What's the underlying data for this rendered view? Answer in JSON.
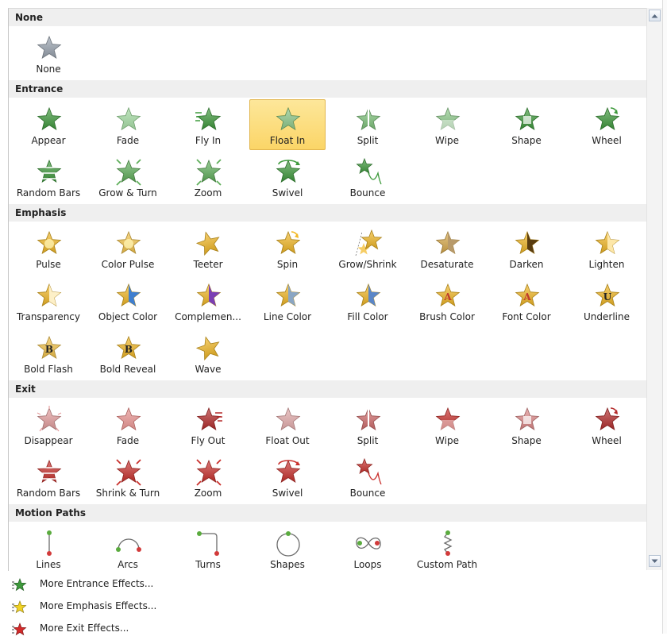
{
  "sections": [
    {
      "title": "None",
      "items": [
        {
          "label": "None",
          "icon": "star-gray-icon",
          "color": "#9aa4b0",
          "variant": "plain"
        }
      ]
    },
    {
      "title": "Entrance",
      "items": [
        {
          "label": "Appear",
          "icon": "entrance-appear-icon",
          "color": "#3e9a3c",
          "variant": "plain"
        },
        {
          "label": "Fade",
          "icon": "entrance-fade-icon",
          "color": "#6cc26a",
          "variant": "fade"
        },
        {
          "label": "Fly In",
          "icon": "entrance-fly-in-icon",
          "color": "#3e9a3c",
          "variant": "fly"
        },
        {
          "label": "Float In",
          "icon": "entrance-float-in-icon",
          "color": "#5faf5a",
          "variant": "float",
          "selected": true
        },
        {
          "label": "Split",
          "icon": "entrance-split-icon",
          "color": "#7fc47c",
          "variant": "split"
        },
        {
          "label": "Wipe",
          "icon": "entrance-wipe-icon",
          "color": "#8fcc8c",
          "variant": "wipe"
        },
        {
          "label": "Shape",
          "icon": "entrance-shape-icon",
          "color": "#3e9a3c",
          "variant": "shape"
        },
        {
          "label": "Wheel",
          "icon": "entrance-wheel-icon",
          "color": "#3e9a3c",
          "variant": "wheel"
        },
        {
          "label": "Random Bars",
          "icon": "entrance-random-bars-icon",
          "color": "#3e9a3c",
          "variant": "bars"
        },
        {
          "label": "Grow & Turn",
          "icon": "entrance-grow-turn-icon",
          "color": "#5faf5a",
          "variant": "grow"
        },
        {
          "label": "Zoom",
          "icon": "entrance-zoom-icon",
          "color": "#5faf5a",
          "variant": "zoom"
        },
        {
          "label": "Swivel",
          "icon": "entrance-swivel-icon",
          "color": "#3e9a3c",
          "variant": "swivel"
        },
        {
          "label": "Bounce",
          "icon": "entrance-bounce-icon",
          "color": "#3e9a3c",
          "variant": "bounce"
        }
      ]
    },
    {
      "title": "Emphasis",
      "items": [
        {
          "label": "Pulse",
          "icon": "emphasis-pulse-icon",
          "color": "#f2b824",
          "variant": "glow"
        },
        {
          "label": "Color Pulse",
          "icon": "emphasis-color-pulse-icon",
          "color": "#f5c54a",
          "variant": "glow"
        },
        {
          "label": "Teeter",
          "icon": "emphasis-teeter-icon",
          "color": "#f2b824",
          "variant": "teeter"
        },
        {
          "label": "Spin",
          "icon": "emphasis-spin-icon",
          "color": "#f2b824",
          "variant": "wheel"
        },
        {
          "label": "Grow/Shrink",
          "icon": "emphasis-grow-shrink-icon",
          "color": "#f2b824",
          "variant": "growshrink"
        },
        {
          "label": "Desaturate",
          "icon": "emphasis-desaturate-icon",
          "color": "#d8a94a",
          "variant": "half",
          "color2": "#b89a6a"
        },
        {
          "label": "Darken",
          "icon": "emphasis-darken-icon",
          "color": "#f2b824",
          "variant": "half",
          "color2": "#5a3d10"
        },
        {
          "label": "Lighten",
          "icon": "emphasis-lighten-icon",
          "color": "#f2b824",
          "variant": "half",
          "color2": "#fde7a8"
        },
        {
          "label": "Transparency",
          "icon": "emphasis-transparency-icon",
          "color": "#f2b824",
          "variant": "half",
          "color2": "#fdf0c8"
        },
        {
          "label": "Object Color",
          "icon": "emphasis-object-color-icon",
          "color": "#f2b824",
          "variant": "half",
          "color2": "#3f7fd0"
        },
        {
          "label": "Complemen...",
          "icon": "emphasis-complementary-icon",
          "color": "#f2b824",
          "variant": "half",
          "color2": "#7b3fb4"
        },
        {
          "label": "Line Color",
          "icon": "emphasis-line-color-icon",
          "color": "#f2b824",
          "variant": "half",
          "color2": "#8aa6c4"
        },
        {
          "label": "Fill Color",
          "icon": "emphasis-fill-color-icon",
          "color": "#f2b824",
          "variant": "half",
          "color2": "#5a86c8"
        },
        {
          "label": "Brush Color",
          "icon": "emphasis-brush-color-icon",
          "color": "#f2b824",
          "variant": "letter",
          "letter": "A",
          "color2": "#c0392b"
        },
        {
          "label": "Font Color",
          "icon": "emphasis-font-color-icon",
          "color": "#f2b824",
          "variant": "letter",
          "letter": "A",
          "color2": "#c0392b"
        },
        {
          "label": "Underline",
          "icon": "emphasis-underline-icon",
          "color": "#f2b824",
          "variant": "letter",
          "letter": "U",
          "color2": "#222222"
        },
        {
          "label": "Bold Flash",
          "icon": "emphasis-bold-flash-icon",
          "color": "#f5c54a",
          "variant": "letter",
          "letter": "B",
          "color2": "#222222"
        },
        {
          "label": "Bold Reveal",
          "icon": "emphasis-bold-reveal-icon",
          "color": "#f2b824",
          "variant": "letter",
          "letter": "B",
          "color2": "#222222"
        },
        {
          "label": "Wave",
          "icon": "emphasis-wave-icon",
          "color": "#f2b824",
          "variant": "teeter"
        }
      ]
    },
    {
      "title": "Exit",
      "items": [
        {
          "label": "Disappear",
          "icon": "exit-disappear-icon",
          "color": "#e6a0a0",
          "variant": "burst"
        },
        {
          "label": "Fade",
          "icon": "exit-fade-icon",
          "color": "#d9534f",
          "variant": "fade"
        },
        {
          "label": "Fly Out",
          "icon": "exit-fly-out-icon",
          "color": "#b52b2b",
          "variant": "flyout"
        },
        {
          "label": "Float Out",
          "icon": "exit-float-out-icon",
          "color": "#d58a8a",
          "variant": "float"
        },
        {
          "label": "Split",
          "icon": "exit-split-icon",
          "color": "#d26d6d",
          "variant": "split"
        },
        {
          "label": "Wipe",
          "icon": "exit-wipe-icon",
          "color": "#c9302c",
          "variant": "wipe"
        },
        {
          "label": "Shape",
          "icon": "exit-shape-icon",
          "color": "#e08a8a",
          "variant": "shape"
        },
        {
          "label": "Wheel",
          "icon": "exit-wheel-icon",
          "color": "#b52b2b",
          "variant": "wheel"
        },
        {
          "label": "Random Bars",
          "icon": "exit-random-bars-icon",
          "color": "#c9302c",
          "variant": "bars"
        },
        {
          "label": "Shrink & Turn",
          "icon": "exit-shrink-turn-icon",
          "color": "#c9302c",
          "variant": "grow"
        },
        {
          "label": "Zoom",
          "icon": "exit-zoom-icon",
          "color": "#c9302c",
          "variant": "zoom"
        },
        {
          "label": "Swivel",
          "icon": "exit-swivel-icon",
          "color": "#c9302c",
          "variant": "swivel"
        },
        {
          "label": "Bounce",
          "icon": "exit-bounce-icon",
          "color": "#c9302c",
          "variant": "bounce"
        }
      ]
    },
    {
      "title": "Motion Paths",
      "items": [
        {
          "label": "Lines",
          "icon": "motion-lines-icon",
          "variant": "path-lines"
        },
        {
          "label": "Arcs",
          "icon": "motion-arcs-icon",
          "variant": "path-arcs"
        },
        {
          "label": "Turns",
          "icon": "motion-turns-icon",
          "variant": "path-turns"
        },
        {
          "label": "Shapes",
          "icon": "motion-shapes-icon",
          "variant": "path-shapes"
        },
        {
          "label": "Loops",
          "icon": "motion-loops-icon",
          "variant": "path-loops"
        },
        {
          "label": "Custom Path",
          "icon": "motion-custom-path-icon",
          "variant": "path-custom"
        }
      ]
    }
  ],
  "more_effects": [
    {
      "label": "More Entrance Effects...",
      "icon": "more-entrance-icon",
      "color": "#3e9a3c"
    },
    {
      "label": "More Emphasis Effects...",
      "icon": "more-emphasis-icon",
      "color": "#f2d324"
    },
    {
      "label": "More Exit Effects...",
      "icon": "more-exit-icon",
      "color": "#d42a2a"
    }
  ],
  "scrollbar": {
    "up_icon": "scroll-up-arrow-icon",
    "down_icon": "scroll-down-arrow-icon"
  }
}
